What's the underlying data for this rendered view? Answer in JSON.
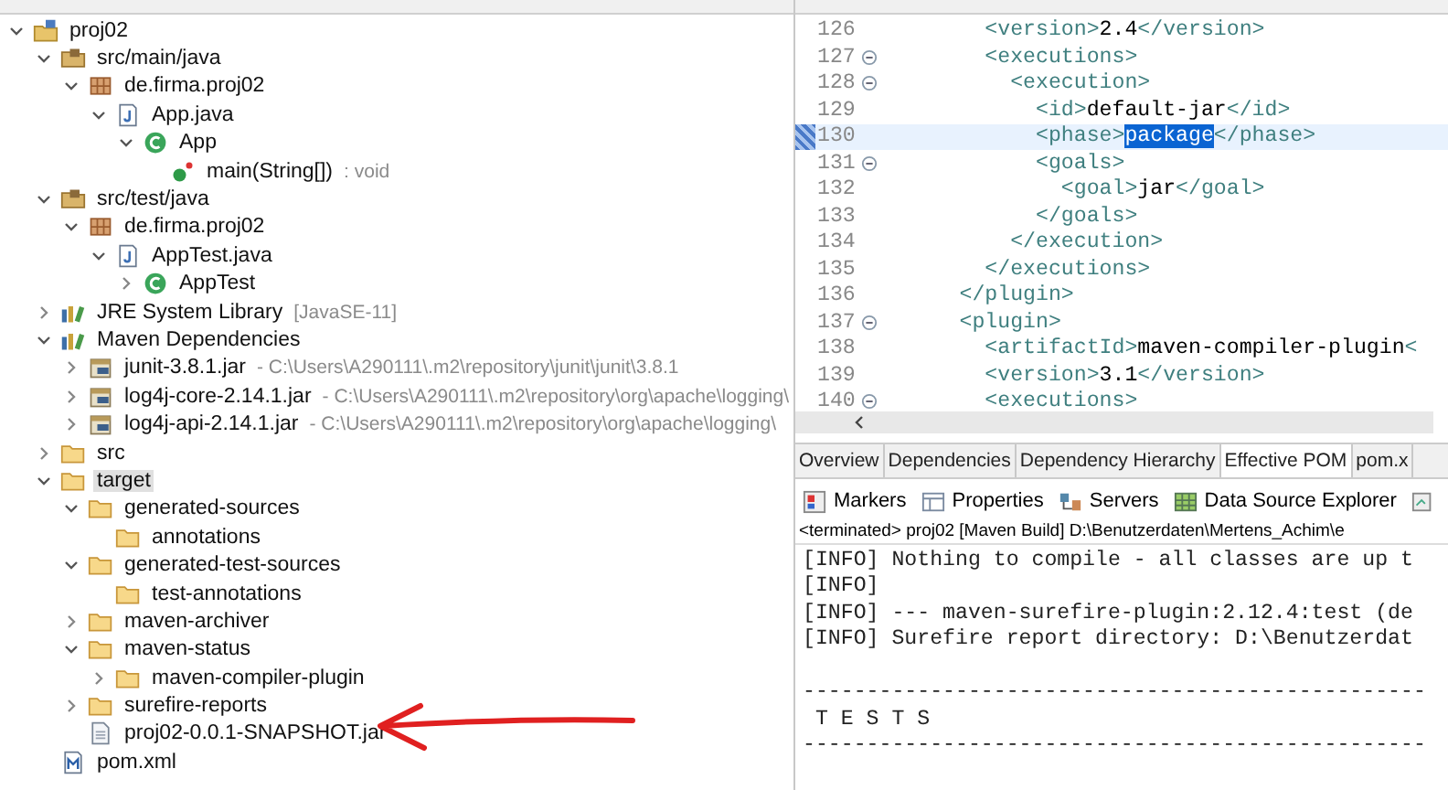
{
  "tree": [
    {
      "label": "proj02",
      "kind": "project",
      "expanded": true,
      "selected": false,
      "children": [
        {
          "label": "src/main/java",
          "kind": "source-folder",
          "expanded": true,
          "selected": false,
          "children": [
            {
              "label": "de.firma.proj02",
              "kind": "package",
              "expanded": true,
              "selected": false,
              "children": [
                {
                  "label": "App.java",
                  "kind": "java-file",
                  "expanded": true,
                  "selected": false,
                  "children": [
                    {
                      "label": "App",
                      "kind": "class",
                      "expanded": true,
                      "selected": false,
                      "children": [
                        {
                          "label": "main(String[])",
                          "detail": ": void",
                          "kind": "method",
                          "selected": false
                        }
                      ]
                    }
                  ]
                }
              ]
            }
          ]
        },
        {
          "label": "src/test/java",
          "kind": "source-folder",
          "expanded": true,
          "selected": false,
          "children": [
            {
              "label": "de.firma.proj02",
              "kind": "package",
              "expanded": true,
              "selected": false,
              "children": [
                {
                  "label": "AppTest.java",
                  "kind": "java-file",
                  "expanded": true,
                  "selected": false,
                  "children": [
                    {
                      "label": "AppTest",
                      "kind": "class",
                      "expanded": false,
                      "selected": false
                    }
                  ]
                }
              ]
            }
          ]
        },
        {
          "label": "JRE System Library",
          "detail": "[JavaSE-11]",
          "kind": "library",
          "expanded": false,
          "selected": false
        },
        {
          "label": "Maven Dependencies",
          "kind": "library",
          "expanded": true,
          "selected": false,
          "children": [
            {
              "label": "junit-3.8.1.jar",
              "detail": "- C:\\Users\\A290111\\.m2\\repository\\junit\\junit\\3.8.1",
              "kind": "jar",
              "expanded": false,
              "selected": false
            },
            {
              "label": "log4j-core-2.14.1.jar",
              "detail": "- C:\\Users\\A290111\\.m2\\repository\\org\\apache\\logging\\",
              "kind": "jar",
              "expanded": false,
              "selected": false
            },
            {
              "label": "log4j-api-2.14.1.jar",
              "detail": "- C:\\Users\\A290111\\.m2\\repository\\org\\apache\\logging\\",
              "kind": "jar",
              "expanded": false,
              "selected": false
            }
          ]
        },
        {
          "label": "src",
          "kind": "folder",
          "expanded": false,
          "selected": false
        },
        {
          "label": "target",
          "kind": "folder",
          "expanded": true,
          "selected": true,
          "children": [
            {
              "label": "generated-sources",
              "kind": "folder",
              "expanded": true,
              "selected": false,
              "children": [
                {
                  "label": "annotations",
                  "kind": "folder",
                  "selected": false
                }
              ]
            },
            {
              "label": "generated-test-sources",
              "kind": "folder",
              "expanded": true,
              "selected": false,
              "children": [
                {
                  "label": "test-annotations",
                  "kind": "folder",
                  "selected": false
                }
              ]
            },
            {
              "label": "maven-archiver",
              "kind": "folder",
              "expanded": false,
              "selected": false
            },
            {
              "label": "maven-status",
              "kind": "folder",
              "expanded": true,
              "selected": false,
              "children": [
                {
                  "label": "maven-compiler-plugin",
                  "kind": "folder",
                  "expanded": false,
                  "selected": false
                }
              ]
            },
            {
              "label": "surefire-reports",
              "kind": "folder",
              "expanded": false,
              "selected": false
            },
            {
              "label": "proj02-0.0.1-SNAPSHOT.jar",
              "kind": "file",
              "selected": false
            }
          ]
        },
        {
          "label": "pom.xml",
          "kind": "xml",
          "selected": false
        }
      ]
    }
  ],
  "editor": {
    "lines": [
      {
        "number": "126",
        "current": false,
        "segments": [
          {
            "text": "        <version>2.4</version>"
          }
        ]
      },
      {
        "number": "127",
        "foldable": true,
        "current": false,
        "segments": [
          {
            "text": "        <executions>"
          }
        ]
      },
      {
        "number": "128",
        "foldable": true,
        "current": false,
        "segments": [
          {
            "text": "          <execution>"
          }
        ]
      },
      {
        "number": "129",
        "current": false,
        "segments": [
          {
            "text": "            <id>default-jar</id>"
          }
        ]
      },
      {
        "number": "130",
        "current": true,
        "segments": [
          {
            "text": "            <phase>"
          },
          {
            "text": "package",
            "selected": true
          },
          {
            "text": "</phase>"
          }
        ]
      },
      {
        "number": "131",
        "foldable": true,
        "current": false,
        "segments": [
          {
            "text": "            <goals>"
          }
        ]
      },
      {
        "number": "132",
        "current": false,
        "segments": [
          {
            "text": "              <goal>jar</goal>"
          }
        ]
      },
      {
        "number": "133",
        "current": false,
        "segments": [
          {
            "text": "            </goals>"
          }
        ]
      },
      {
        "number": "134",
        "current": false,
        "segments": [
          {
            "text": "          </execution>"
          }
        ]
      },
      {
        "number": "135",
        "current": false,
        "segments": [
          {
            "text": "        </executions>"
          }
        ]
      },
      {
        "number": "136",
        "current": false,
        "segments": [
          {
            "text": "      </plugin>"
          }
        ]
      },
      {
        "number": "137",
        "foldable": true,
        "current": false,
        "segments": [
          {
            "text": "      <plugin>"
          }
        ]
      },
      {
        "number": "138",
        "current": false,
        "segments": [
          {
            "text": "        <artifactId>maven-compiler-plugin<"
          }
        ]
      },
      {
        "number": "139",
        "current": false,
        "segments": [
          {
            "text": "        <version>3.1</version>"
          }
        ]
      },
      {
        "number": "140",
        "foldable": true,
        "current": false,
        "segments": [
          {
            "text": "        <executions>"
          }
        ]
      }
    ]
  },
  "pom_tabs": [
    {
      "label": "Overview",
      "selected": false
    },
    {
      "label": "Dependencies",
      "selected": false
    },
    {
      "label": "Dependency Hierarchy",
      "selected": false
    },
    {
      "label": "Effective POM",
      "selected": true
    },
    {
      "label": "pom.x",
      "selected": false
    }
  ],
  "views": [
    {
      "label": "Markers",
      "kind": "markers"
    },
    {
      "label": "Properties",
      "kind": "properties"
    },
    {
      "label": "Servers",
      "kind": "servers"
    },
    {
      "label": "Data Source Explorer",
      "kind": "datasource"
    }
  ],
  "console": {
    "header": "<terminated> proj02 [Maven Build] D:\\Benutzerdaten\\Mertens_Achim\\e",
    "blocks": [
      [
        "[INFO] Nothing to compile - all classes are up t",
        "[INFO]",
        "[INFO] --- maven-surefire-plugin:2.12.4:test (de",
        "[INFO] Surefire report directory: D:\\Benutzerdat"
      ],
      [
        "-------------------------------------------------",
        " T E S T S",
        "-------------------------------------------------"
      ]
    ]
  }
}
